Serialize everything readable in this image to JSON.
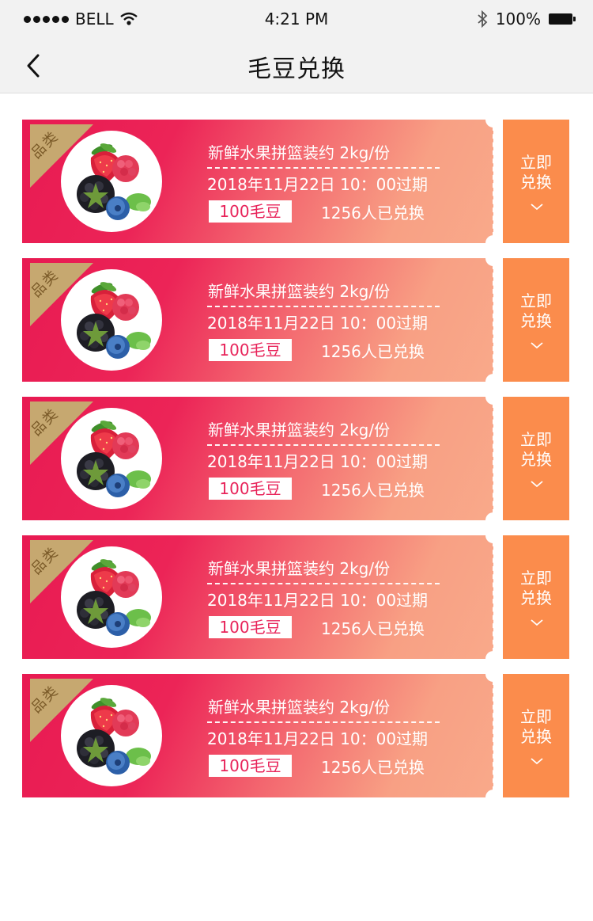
{
  "status_bar": {
    "carrier": "BELL",
    "time": "4:21 PM",
    "battery": "100%"
  },
  "nav": {
    "title": "毛豆兑换"
  },
  "coupons": [
    {
      "category": "品类",
      "title": "新鲜水果拼篮装约 2kg/份",
      "expire": "2018年11月22日  10：00过期",
      "points": "100毛豆",
      "exchanged": "1256人已兑换",
      "action": "立即兑换"
    },
    {
      "category": "品类",
      "title": "新鲜水果拼篮装约 2kg/份",
      "expire": "2018年11月22日  10：00过期",
      "points": "100毛豆",
      "exchanged": "1256人已兑换",
      "action": "立即兑换"
    },
    {
      "category": "品类",
      "title": "新鲜水果拼篮装约 2kg/份",
      "expire": "2018年11月22日  10：00过期",
      "points": "100毛豆",
      "exchanged": "1256人已兑换",
      "action": "立即兑换"
    },
    {
      "category": "品类",
      "title": "新鲜水果拼篮装约 2kg/份",
      "expire": "2018年11月22日  10：00过期",
      "points": "100毛豆",
      "exchanged": "1256人已兑换",
      "action": "立即兑换"
    },
    {
      "category": "品类",
      "title": "新鲜水果拼篮装约 2kg/份",
      "expire": "2018年11月22日  10：00过期",
      "points": "100毛豆",
      "exchanged": "1256人已兑换",
      "action": "立即兑换"
    }
  ],
  "icons": {
    "back": "chevron-left-icon",
    "signal": "signal-dots-icon",
    "wifi": "wifi-icon",
    "bluetooth": "bluetooth-icon",
    "battery": "battery-icon",
    "expand": "chevron-down-icon",
    "product": "fruit-basket-image"
  },
  "colors": {
    "coupon_gradient_start": "#e81a52",
    "coupon_gradient_end": "#f9a98a",
    "stub": "#fb8c4c",
    "category_tag": "#c6a870",
    "points_text": "#e8245a"
  }
}
